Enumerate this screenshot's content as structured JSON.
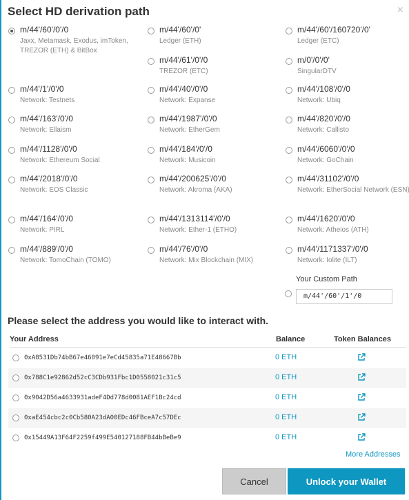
{
  "title": "Select HD derivation path",
  "paths": [
    {
      "value": "m/44'/60'/0'/0",
      "network": "Jaxx, Metamask, Exodus, imToken, TREZOR (ETH) & BitBox",
      "checked": true
    },
    {
      "value": "m/44'/60'/0'",
      "network": "Ledger (ETH)"
    },
    {
      "value": "m/44'/60'/160720'/0'",
      "network": "Ledger (ETC)"
    },
    {
      "value": "m/44'/61'/0'/0",
      "network": "TREZOR (ETC)"
    },
    {
      "value": "m/0'/0'/0'",
      "network": "SingularDTV"
    },
    {
      "value": "m/44'/1'/0'/0",
      "network": "Network: Testnets"
    },
    {
      "value": "m/44'/40'/0'/0",
      "network": "Network: Expanse"
    },
    {
      "value": "m/44'/108'/0'/0",
      "network": "Network: Ubiq"
    },
    {
      "value": "m/44'/163'/0'/0",
      "network": "Network: Ellaism"
    },
    {
      "value": "m/44'/1987'/0'/0",
      "network": "Network: EtherGem"
    },
    {
      "value": "m/44'/820'/0'/0",
      "network": "Network: Callisto"
    },
    {
      "value": "m/44'/1128'/0'/0",
      "network": "Network: Ethereum Social"
    },
    {
      "value": "m/44'/184'/0'/0",
      "network": "Network: Musicoin"
    },
    {
      "value": "m/44'/6060'/0'/0",
      "network": "Network: GoChain"
    },
    {
      "value": "m/44'/2018'/0'/0",
      "network": "Network: EOS Classic"
    },
    {
      "value": "m/44'/200625'/0'/0",
      "network": "Network: Akroma (AKA)"
    },
    {
      "value": "m/44'/31102'/0'/0",
      "network": "Network: EtherSocial Network (ESN)"
    },
    {
      "value": "m/44'/164'/0'/0",
      "network": "Network: PIRL"
    },
    {
      "value": "m/44'/1313114'/0'/0",
      "network": "Network: Ether-1 (ETHO)"
    },
    {
      "value": "m/44'/1620'/0'/0",
      "network": "Network: Atheios (ATH)"
    },
    {
      "value": "m/44'/889'/0'/0",
      "network": "Network: TomoChain (TOMO)"
    },
    {
      "value": "m/44'/76'/0'/0",
      "network": "Network: Mix Blockchain (MIX)"
    },
    {
      "value": "m/44'/1171337'/0'/0",
      "network": "Network: Iolite (ILT)"
    }
  ],
  "custom": {
    "label": "Your Custom Path",
    "value": "m/44'/60'/1'/0"
  },
  "subtitle": "Please select the address you would like to interact with.",
  "columns": {
    "address": "Your Address",
    "balance": "Balance",
    "tokens": "Token Balances"
  },
  "addresses": [
    {
      "address": "0xA8531Db74bB67e46091e7eCd45835a71E48667Bb",
      "balance": "0 ETH"
    },
    {
      "address": "0x788C1e92862d52cC3CDb931Fbc1D0558021c31c5",
      "balance": "0 ETH"
    },
    {
      "address": "0x9042D56a4633931adeF4Dd778d0081AEF1Bc24cd",
      "balance": "0 ETH"
    },
    {
      "address": "0xaE454cbc2c0Cb580A23dA00EDc46FBceA7c57DEc",
      "balance": "0 ETH"
    },
    {
      "address": "0x15449A13F64F2259f499E540127188FB44bBeBe9",
      "balance": "0 ETH"
    }
  ],
  "more_addresses": "More Addresses",
  "cancel": "Cancel",
  "unlock": "Unlock your Wallet",
  "colors": {
    "accent": "#0e97c0",
    "cancel_bg": "#cccccc"
  },
  "icons": {
    "close": "close-icon",
    "external": "external-link-icon"
  }
}
